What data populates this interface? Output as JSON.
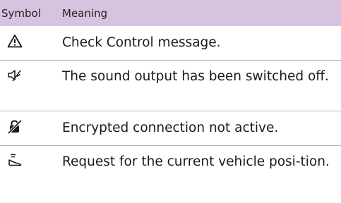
{
  "table": {
    "header": {
      "symbol": "Symbol",
      "meaning": "Meaning"
    },
    "rows": [
      {
        "icon": "warning-triangle-icon",
        "meaning": "Check Control message."
      },
      {
        "icon": "sound-off-icon",
        "meaning": "The sound output has been switched off."
      },
      {
        "icon": "encryption-inactive-icon",
        "meaning": "Encrypted connection not active."
      },
      {
        "icon": "vehicle-position-request-icon",
        "meaning": "Request for the current vehicle posi-tion."
      }
    ]
  }
}
